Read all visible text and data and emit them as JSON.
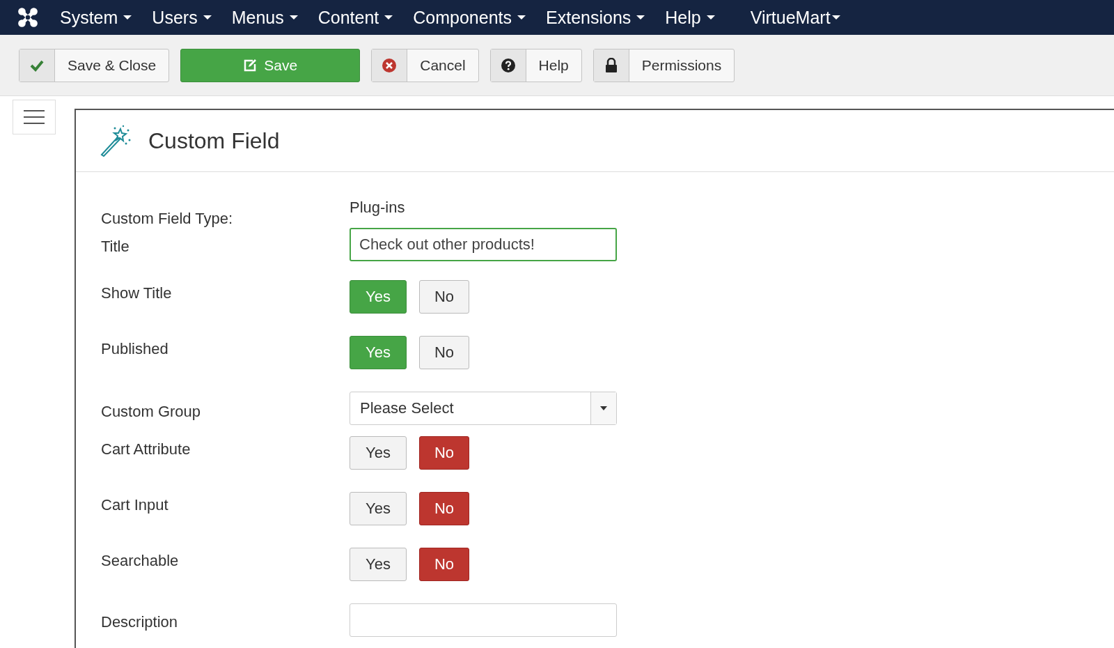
{
  "nav": {
    "items": [
      {
        "label": "System"
      },
      {
        "label": "Users"
      },
      {
        "label": "Menus"
      },
      {
        "label": "Content"
      },
      {
        "label": "Components"
      },
      {
        "label": "Extensions"
      },
      {
        "label": "Help"
      },
      {
        "label": "VirtueMart"
      }
    ]
  },
  "toolbar": [
    {
      "kind": "check",
      "label": "Save & Close",
      "primary": false
    },
    {
      "kind": "edit",
      "label": "Save",
      "primary": true
    },
    {
      "kind": "cancel",
      "label": "Cancel",
      "primary": false
    },
    {
      "kind": "help",
      "label": "Help",
      "primary": false
    },
    {
      "kind": "lock",
      "label": "Permissions",
      "primary": false
    }
  ],
  "page": {
    "title": "Custom Field"
  },
  "fields": [
    {
      "kind": "text",
      "label": "Custom Field Type:",
      "value": "Plug-ins"
    },
    {
      "kind": "input",
      "label": "Title",
      "value": "Check out other products!"
    },
    {
      "kind": "toggle",
      "label": "Show Title",
      "options": [
        {
          "label": "Yes",
          "selected": true
        },
        {
          "label": "No",
          "selected": false
        }
      ]
    },
    {
      "kind": "toggle",
      "label": "Published",
      "options": [
        {
          "label": "Yes",
          "selected": true
        },
        {
          "label": "No",
          "selected": false
        }
      ]
    },
    {
      "kind": "select",
      "label": "Custom Group",
      "value": "Please Select"
    },
    {
      "kind": "toggle",
      "label": "Cart Attribute",
      "options": [
        {
          "label": "Yes",
          "selected": false
        },
        {
          "label": "No",
          "selected": true
        }
      ]
    },
    {
      "kind": "toggle",
      "label": "Cart Input",
      "options": [
        {
          "label": "Yes",
          "selected": false
        },
        {
          "label": "No",
          "selected": true
        }
      ]
    },
    {
      "kind": "toggle",
      "label": "Searchable",
      "options": [
        {
          "label": "Yes",
          "selected": false
        },
        {
          "label": "No",
          "selected": true
        }
      ]
    },
    {
      "kind": "input",
      "label": "Description"
    }
  ]
}
